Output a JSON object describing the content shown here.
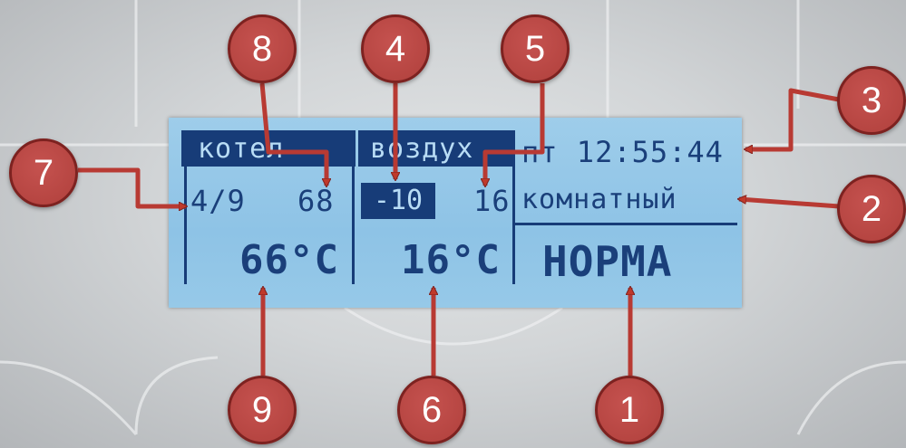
{
  "display": {
    "header": {
      "boiler": "котел",
      "air": "воздух"
    },
    "datetime": "пт 12:55:44",
    "mode": "комнатный",
    "boiler_row": {
      "stage": "4/9",
      "setpoint": "68"
    },
    "air_row": {
      "outdoor": "-10",
      "setpoint": "16"
    },
    "boiler_temp": "66°C",
    "air_temp": "16°C",
    "status": "НОРМА"
  },
  "callouts": [
    "1",
    "2",
    "3",
    "4",
    "5",
    "6",
    "7",
    "8",
    "9"
  ],
  "colors": {
    "lcd_background": "#8ec3e6",
    "lcd_text": "#1a3f7a",
    "lcd_inverse": "#173c78",
    "callout": "#b0403c",
    "arrow": "#c0392b"
  }
}
